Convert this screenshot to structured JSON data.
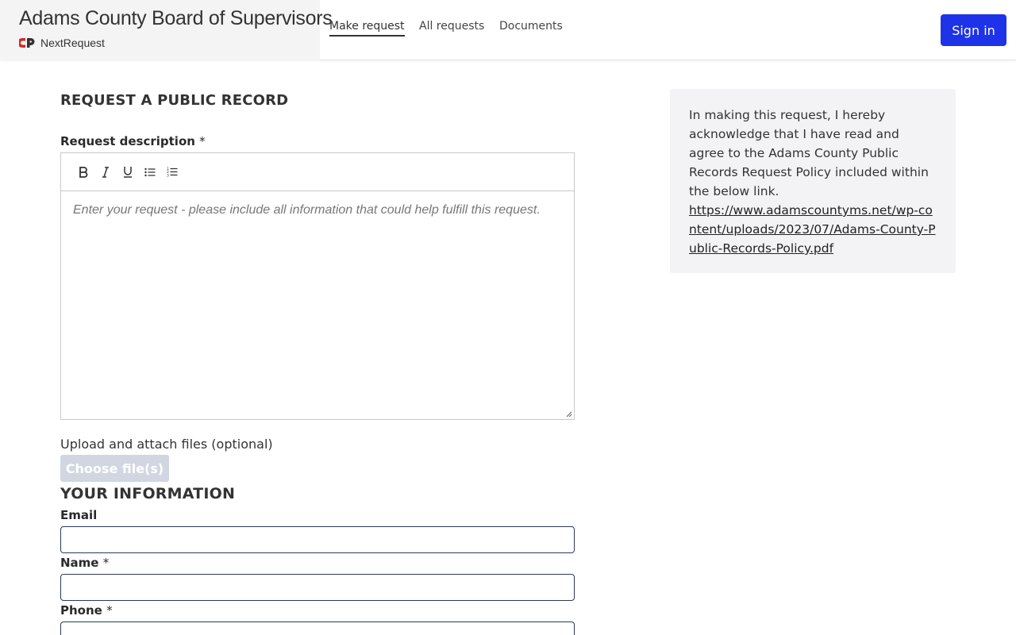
{
  "header": {
    "org_title": "Adams County Board of Supervisors",
    "logo_text": "NextRequest",
    "nav": [
      {
        "label": "Make request",
        "active": true
      },
      {
        "label": "All requests",
        "active": false
      },
      {
        "label": "Documents",
        "active": false
      }
    ],
    "signin_label": "Sign in",
    "accent_color": "#1e33e8"
  },
  "form": {
    "title": "REQUEST A PUBLIC RECORD",
    "description_label": "Request description",
    "required_mark": "*",
    "toolbar_icons": [
      "bold-icon",
      "italic-icon",
      "underline-icon",
      "bulleted-list-icon",
      "numbered-list-icon"
    ],
    "description_placeholder": "Enter your request - please include all information that could help fulfill this request.",
    "upload_label": "Upload and attach files (optional)",
    "choose_files_label": "Choose file(s)",
    "your_info_title": "YOUR INFORMATION",
    "fields": [
      {
        "label": "Email",
        "required": false
      },
      {
        "label": "Name",
        "required": true
      },
      {
        "label": "Phone",
        "required": true
      }
    ]
  },
  "sidebar": {
    "notice": "In making this request, I hereby acknowledge that I have read and agree to the Adams County Public Records Request Policy included within the below link.",
    "policy_link": "https://www.adamscountyms.net/wp-content/uploads/2023/07/Adams-County-Public-Records-Policy.pdf"
  }
}
